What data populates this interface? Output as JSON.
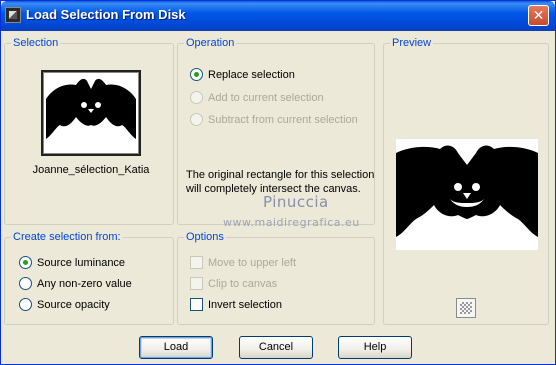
{
  "window": {
    "title": "Load Selection From Disk",
    "close_glyph": "✕"
  },
  "selection_group": {
    "label": "Selection",
    "filename": "Joanne_sélection_Katia"
  },
  "operation_group": {
    "label": "Operation",
    "options": [
      {
        "label": "Replace selection",
        "selected": true,
        "enabled": true
      },
      {
        "label": "Add to current selection",
        "selected": false,
        "enabled": false
      },
      {
        "label": "Subtract from current selection",
        "selected": false,
        "enabled": false
      }
    ],
    "note": "The original rectangle for this selection will completely intersect the canvas."
  },
  "preview_group": {
    "label": "Preview",
    "zoom_icon": "checker-icon"
  },
  "create_group": {
    "label": "Create selection from:",
    "options": [
      {
        "label": "Source luminance",
        "selected": true
      },
      {
        "label": "Any non-zero value",
        "selected": false
      },
      {
        "label": "Source opacity",
        "selected": false
      }
    ]
  },
  "options_group": {
    "label": "Options",
    "items": [
      {
        "label": "Move to upper left",
        "checked": false,
        "enabled": false
      },
      {
        "label": "Clip to canvas",
        "checked": false,
        "enabled": false
      },
      {
        "label": "Invert selection",
        "checked": false,
        "enabled": true
      }
    ]
  },
  "buttons": {
    "load": "Load",
    "cancel": "Cancel",
    "help": "Help"
  },
  "watermark": {
    "line1": "Pinuccia",
    "line2": "www.maidiregrafica.eu"
  },
  "colors": {
    "title_bar": "#0058e6",
    "group_label": "#0046d5",
    "dialog_bg": "#ece9d8"
  }
}
